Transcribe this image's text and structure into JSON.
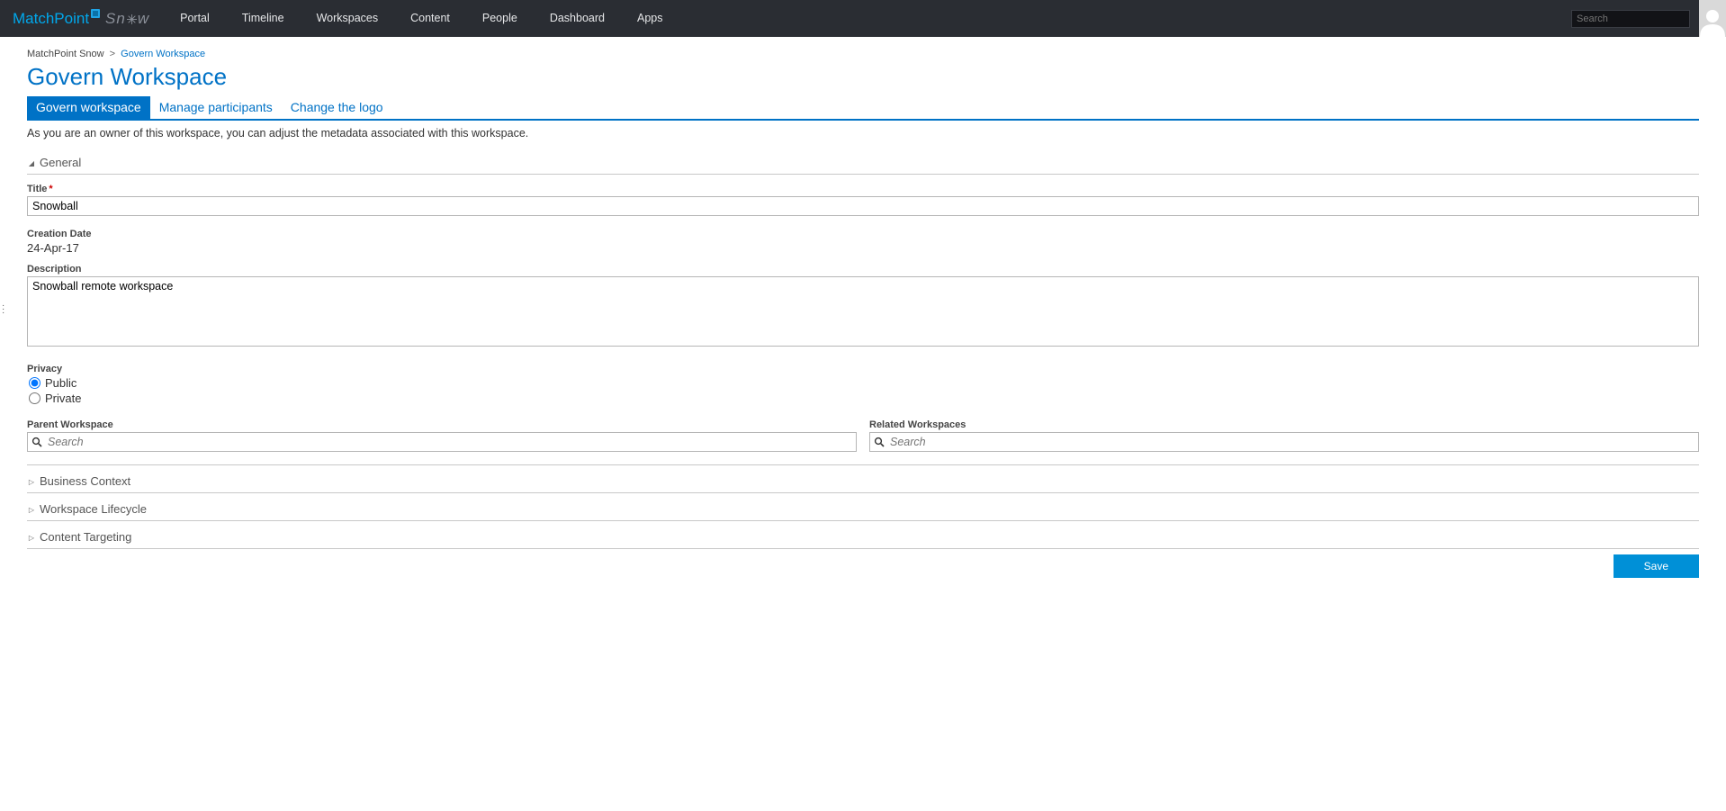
{
  "brand": {
    "match": "Match",
    "point": "Point",
    "snow_s": "Sn",
    "snow_w": "w"
  },
  "nav": [
    "Portal",
    "Timeline",
    "Workspaces",
    "Content",
    "People",
    "Dashboard",
    "Apps"
  ],
  "search_placeholder": "Search",
  "breadcrumb": {
    "root": "MatchPoint Snow",
    "current": "Govern Workspace"
  },
  "page_title": "Govern Workspace",
  "tabs": [
    {
      "label": "Govern workspace",
      "active": true
    },
    {
      "label": "Manage participants",
      "active": false
    },
    {
      "label": "Change the logo",
      "active": false
    }
  ],
  "intro": "As you are an owner of this workspace, you can adjust the metadata associated with this workspace.",
  "sections": {
    "general": "General",
    "business": "Business Context",
    "lifecycle": "Workspace Lifecycle",
    "targeting": "Content Targeting"
  },
  "form": {
    "title_label": "Title",
    "title_value": "Snowball",
    "creation_label": "Creation Date",
    "creation_value": "24-Apr-17",
    "description_label": "Description",
    "description_value": "Snowball remote workspace",
    "privacy_label": "Privacy",
    "privacy_public": "Public",
    "privacy_private": "Private",
    "parent_label": "Parent Workspace",
    "related_label": "Related Workspaces",
    "lookup_placeholder": "Search"
  },
  "save_label": "Save"
}
